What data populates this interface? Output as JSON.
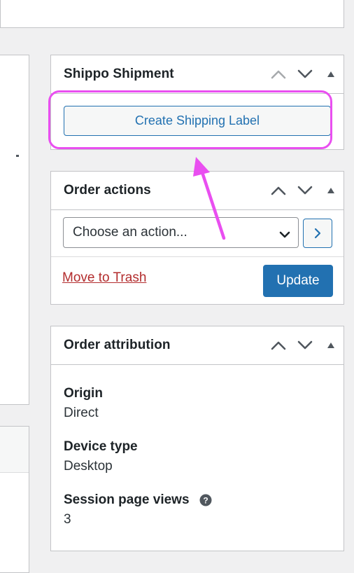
{
  "shippo_box": {
    "title": "Shippo Shipment",
    "create_label_button": "Create Shipping Label"
  },
  "order_actions_box": {
    "title": "Order actions",
    "select_value": "Choose an action...",
    "trash_link": "Move to Trash",
    "update_button": "Update"
  },
  "order_attribution_box": {
    "title": "Order attribution",
    "fields": [
      {
        "label": "Origin",
        "value": "Direct"
      },
      {
        "label": "Device type",
        "value": "Desktop"
      },
      {
        "label": "Session page views",
        "value": "3"
      }
    ]
  },
  "annotation": {
    "highlight_color": "#e94ff0",
    "arrow_color": "#e94ff0"
  },
  "colors": {
    "accent": "#2271b1",
    "danger": "#b32d2e",
    "background": "#f0f0f1"
  },
  "icons": [
    "chevron-up-icon",
    "chevron-down-icon",
    "triangle-up-icon",
    "chevron-right-icon",
    "help-icon"
  ]
}
